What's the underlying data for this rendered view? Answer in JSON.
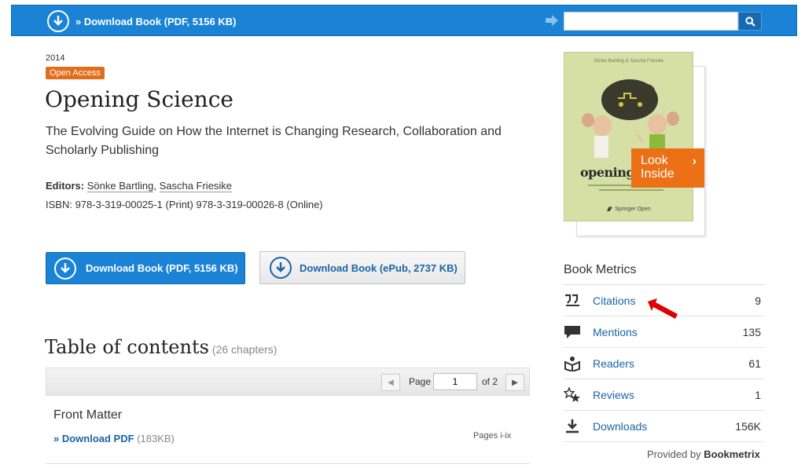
{
  "topbar": {
    "download_label": "» Download Book (PDF, 5156 KB)",
    "search_value": "",
    "search_icon": "magnifier-icon"
  },
  "book": {
    "year": "2014",
    "access_badge": "Open Access",
    "title": "Opening Science",
    "subtitle": "The Evolving Guide on How the Internet is Changing Research, Collaboration and Scholarly Publishing",
    "editors_label": "Editors:",
    "editor_1": "Sönke Bartling",
    "editor_sep": ",",
    "editor_2": "Sascha Friesike",
    "isbn": "ISBN: 978-3-319-00025-1 (Print) 978-3-319-00026-8 (Online)"
  },
  "downloads": {
    "pdf_label": "Download Book (PDF, 5156 KB)",
    "epub_label": "Download Book (ePub, 2737 KB)"
  },
  "toc": {
    "title": "Table of contents",
    "count": "(26 chapters)",
    "page_label": "Page",
    "page_value": "1",
    "of_label": "of 2",
    "front_matter": "Front Matter",
    "download_pdf": "» Download PDF",
    "download_size": "(183KB)",
    "pages": "Pages i-ix"
  },
  "cover": {
    "authors": "Sönke Bartling & Sascha Friesike",
    "name": "opening",
    "publisher": "Springer Open",
    "look_inside": "Look Inside",
    "colors": {
      "cover_bg": "#d6e0a6",
      "look_inside_bg": "#ec7016"
    }
  },
  "metrics": {
    "title": "Book Metrics",
    "rows": [
      {
        "label": "Citations",
        "value": "9",
        "icon": "quote-icon"
      },
      {
        "label": "Mentions",
        "value": "135",
        "icon": "speech-bubble-icon"
      },
      {
        "label": "Readers",
        "value": "61",
        "icon": "reader-icon"
      },
      {
        "label": "Reviews",
        "value": "1",
        "icon": "stars-icon"
      },
      {
        "label": "Downloads",
        "value": "156K",
        "icon": "download-icon"
      }
    ],
    "provided_by": "Provided by",
    "provider": "Bookmetrix"
  },
  "colors": {
    "topbar": "#1a83d6",
    "link": "#1a64a8",
    "badge": "#e26d1b",
    "annotation_arrow": "#e00000"
  }
}
